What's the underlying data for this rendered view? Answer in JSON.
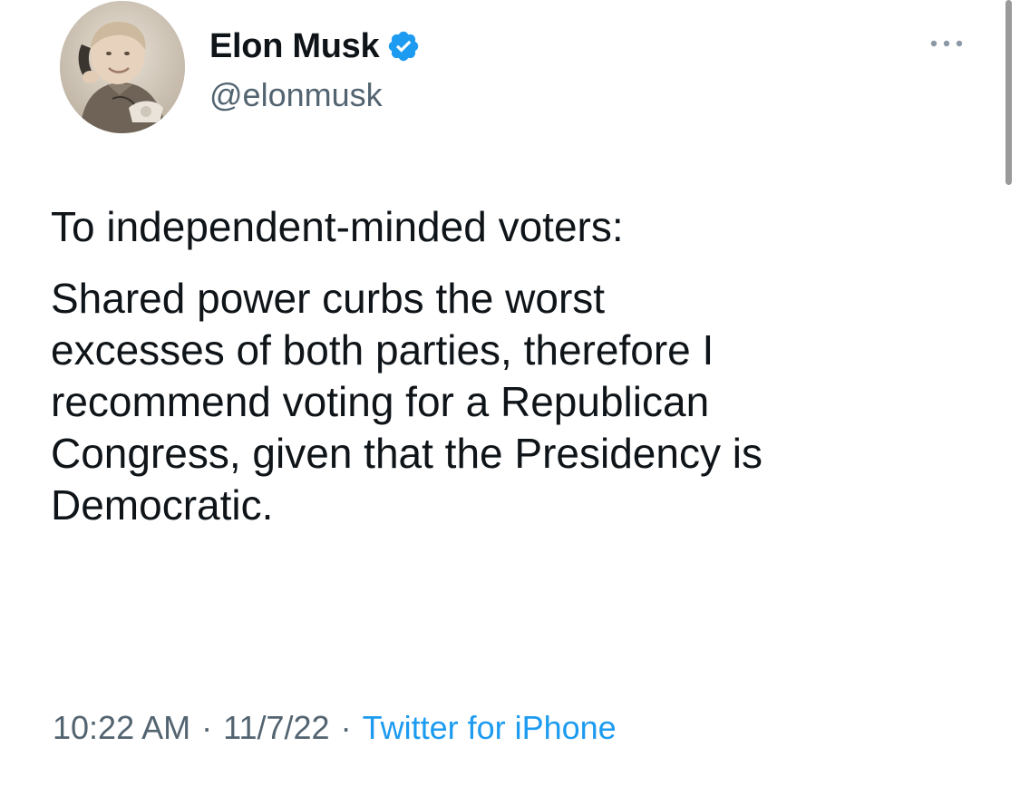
{
  "author": {
    "display_name": "Elon Musk",
    "handle": "@elonmusk",
    "verified": true,
    "verified_color": "#1d9bf0",
    "avatar_icon": "profile-photo-child-with-phone"
  },
  "menu": {
    "icon": "more-horizontal-icon"
  },
  "tweet": {
    "paragraph_1": [
      "To independent-minded voters:"
    ],
    "paragraph_2": [
      "Shared power curbs the worst",
      "excesses of both parties, therefore I",
      "recommend voting for a Republican",
      "Congress, given that the Presidency is",
      "Democratic."
    ]
  },
  "meta": {
    "time": "10:22 AM",
    "separator": "·",
    "date": "11/7/22",
    "source": "Twitter for iPhone",
    "source_color": "#1d9bf0",
    "secondary_text_color": "#536471"
  }
}
